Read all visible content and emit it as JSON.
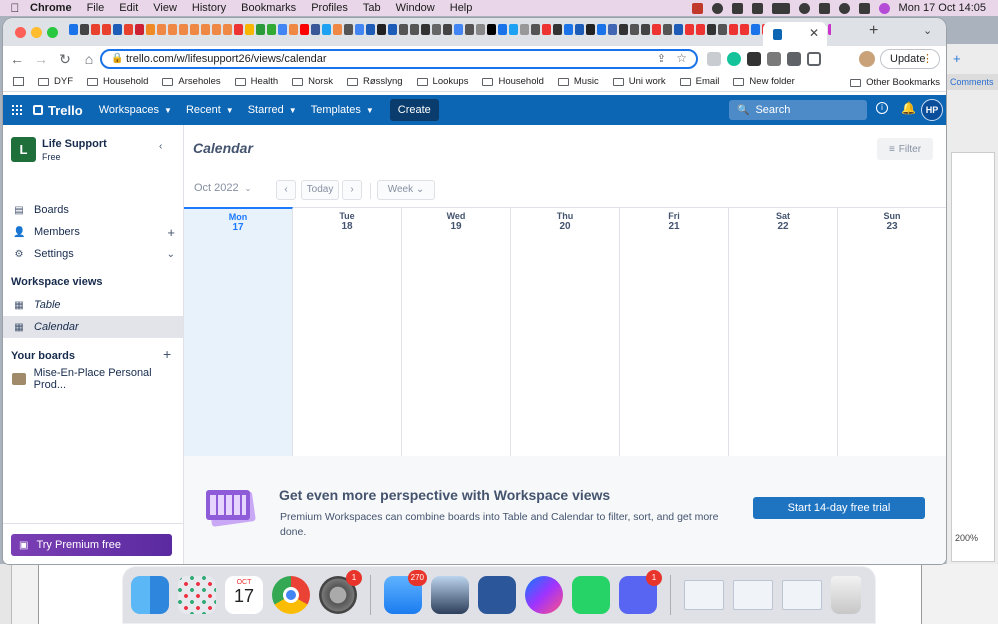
{
  "menubar": {
    "app": "Chrome",
    "items": [
      "File",
      "Edit",
      "View",
      "History",
      "Bookmarks",
      "Profiles",
      "Tab",
      "Window",
      "Help"
    ],
    "clock": "Mon 17 Oct  14:05"
  },
  "bgapp": {
    "comments_label": "Comments",
    "zoom": "200%"
  },
  "browser": {
    "url": "trello.com/w/lifesupport26/views/calendar",
    "update_label": "Update",
    "tab_favicon_colors": [
      "#1a73e8",
      "#444",
      "#e8422e",
      "#e8422e",
      "#1d5db8",
      "#e8422e",
      "#c23",
      "#f08a24",
      "#e84",
      "#e84",
      "#e84",
      "#e84",
      "#e84",
      "#e84",
      "#e84",
      "#e33",
      "#f7b500",
      "#2a9a3a",
      "#3a3",
      "#4285f4",
      "#e84",
      "#ff0000",
      "#3b5998",
      "#1da1f2",
      "#e84",
      "#555",
      "#4285f4",
      "#1d5db8",
      "#222",
      "#1d5db8",
      "#555",
      "#555",
      "#333",
      "#666",
      "#444",
      "#4285f4",
      "#555",
      "#888",
      "#000",
      "#1a73e8",
      "#1da1f2",
      "#999",
      "#555",
      "#e33",
      "#333",
      "#1a73e8",
      "#1d5db8",
      "#222",
      "#1a73e8",
      "#4267b2",
      "#333",
      "#555",
      "#444",
      "#e33",
      "#555",
      "#1d5db8",
      "#e33",
      "#e33",
      "#333",
      "#555",
      "#e33",
      "#e33",
      "#1a73e8",
      "#e33",
      "#c3c",
      "#e33",
      "#333",
      "#1d5db8",
      "#333",
      "#c3c",
      "#e33",
      "#2a9a3a"
    ],
    "bookmarks": [
      "DYF",
      "Household",
      "Arseholes",
      "Health",
      "Norsk",
      "Røsslyng",
      "Lookups",
      "Household",
      "Music",
      "Uni work",
      "Email",
      "New folder"
    ],
    "other_bookmarks": "Other Bookmarks"
  },
  "header": {
    "logo": "Trello",
    "nav": [
      "Workspaces",
      "Recent",
      "Starred",
      "Templates"
    ],
    "create": "Create",
    "search_placeholder": "Search",
    "avatar": "HP"
  },
  "sidebar": {
    "workspace_initial": "L",
    "workspace_name": "Life Support",
    "workspace_plan": "Free",
    "items": [
      {
        "label": "Boards",
        "icon": "board-icon"
      },
      {
        "label": "Members",
        "icon": "person-icon"
      },
      {
        "label": "Settings",
        "icon": "gear-icon"
      }
    ],
    "views_heading": "Workspace views",
    "views": [
      {
        "label": "Table",
        "icon": "table-icon"
      },
      {
        "label": "Calendar",
        "icon": "calendar-icon",
        "selected": true
      }
    ],
    "boards_heading": "Your boards",
    "boards": [
      "Mise-En-Place Personal Prod..."
    ],
    "premium_label": "Try Premium free"
  },
  "calendar": {
    "title": "Calendar",
    "filter_label": "Filter",
    "month": "Oct 2022",
    "today_label": "Today",
    "view_label": "Week",
    "days": [
      {
        "name": "Mon",
        "date": "17",
        "today": true
      },
      {
        "name": "Tue",
        "date": "18"
      },
      {
        "name": "Wed",
        "date": "19"
      },
      {
        "name": "Thu",
        "date": "20"
      },
      {
        "name": "Fri",
        "date": "21"
      },
      {
        "name": "Sat",
        "date": "22"
      },
      {
        "name": "Sun",
        "date": "23"
      }
    ]
  },
  "promo": {
    "title": "Get even more perspective with Workspace views",
    "description": "Premium Workspaces can combine boards into Table and Calendar to filter, sort, and get more done.",
    "button": "Start 14-day free trial"
  },
  "dock": {
    "calendar_month": "OCT",
    "calendar_day": "17",
    "badges": {
      "settings": "1",
      "mail": "270",
      "discord": "1"
    }
  }
}
